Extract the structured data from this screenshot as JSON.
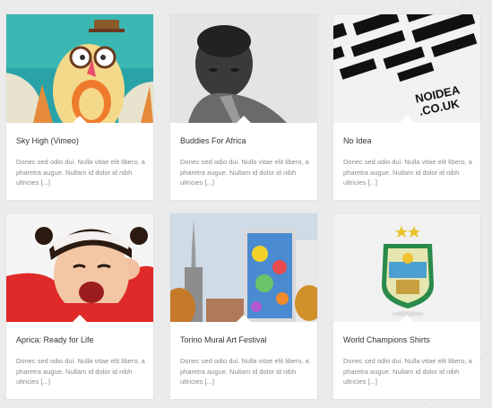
{
  "portfolio": {
    "items": [
      {
        "title": "Sky High (Vimeo)",
        "excerpt": "Donec sed odio dui. Nulla vitae elit libero, a pharetra augue. Nullam id dolor id nibh ultricies [...]",
        "image": "cartoon-pear-character-with-glasses"
      },
      {
        "title": "Buddies For Africa",
        "excerpt": "Donec sed odio dui. Nulla vitae elit libero, a pharetra augue. Nullam id dolor id nibh ultricies [...]",
        "image": "black-and-white-boy-portrait"
      },
      {
        "title": "No Idea",
        "excerpt": "Donec sed odio dui. Nulla vitae elit libero, a pharetra augue. Nullam id dolor id nibh ultricies [...]",
        "image": "noidea-typography-poster",
        "image_text": "NOIDEA .CO.UK"
      },
      {
        "title": "Aprica: Ready for Life",
        "excerpt": "Donec sed odio dui. Nulla vitae elit libero, a pharetra augue. Nullam id dolor id nibh ultricies [...]",
        "image": "shouting-child-in-red"
      },
      {
        "title": "Torino Mural Art Festival",
        "excerpt": "Donec sed odio dui. Nulla vitae elit libero, a pharetra augue. Nullam id dolor id nibh ultricies [...]",
        "image": "painted-building-mural"
      },
      {
        "title": "World Champions Shirts",
        "excerpt": "Donec sed odio dui. Nulla vitae elit libero, a pharetra augue. Nullam id dolor id nibh ultricies [...]",
        "image": "football-crest-badge"
      }
    ]
  },
  "colors": {
    "page_bg": "#ecebeb",
    "card_bg": "#ffffff",
    "title": "#333333",
    "excerpt": "#8a8a8a"
  }
}
